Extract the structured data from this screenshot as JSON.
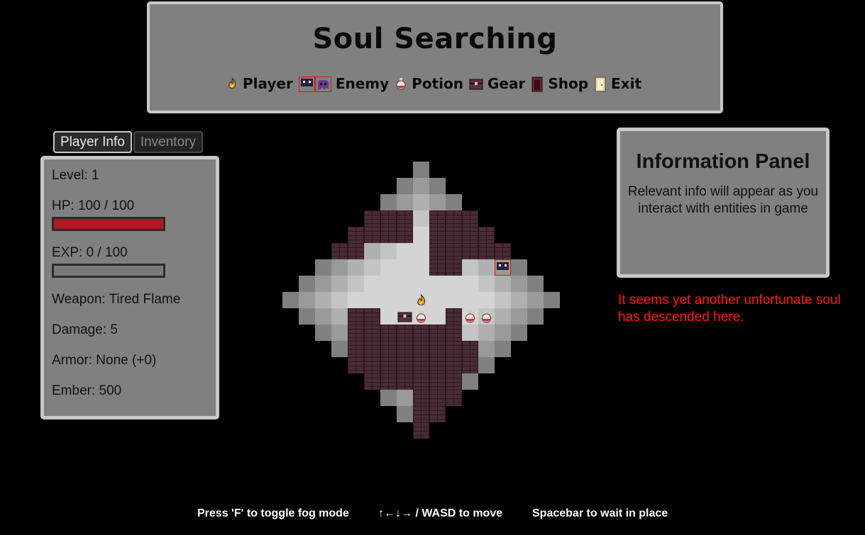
{
  "header": {
    "title": "Soul Searching",
    "legend": {
      "player": "Player",
      "enemy": "Enemy",
      "potion": "Potion",
      "gear": "Gear",
      "shop": "Shop",
      "exit": "Exit"
    }
  },
  "tabs": {
    "player_info": "Player Info",
    "inventory": "Inventory"
  },
  "player": {
    "level": "Level: 1",
    "hp": "HP: 100 / 100",
    "hp_fraction": 1.0,
    "exp": "EXP: 0 / 100",
    "exp_fraction": 0.0,
    "weapon": "Weapon: Tired Flame",
    "damage": "Damage: 5",
    "armor": "Armor: None (+0)",
    "ember": "Ember: 500"
  },
  "info_panel": {
    "title": "Information Panel",
    "text": "Relevant info will appear as you interact with entities in game"
  },
  "message": "It seems yet another unfortunate soul has descended here.",
  "footer": {
    "fog": "Press 'F' to toggle fog mode",
    "move": "↑←↓→ / WASD to move",
    "wait": "Spacebar to wait in place"
  },
  "colors": {
    "accent_red": "#ff1a1a",
    "hp_bar": "#b01822",
    "panel": "#808080",
    "panel_border": "#c8c8c8"
  },
  "icons": {
    "player": "flame-icon",
    "enemy": "ghost-enemy-icon",
    "potion": "potion-flask-icon",
    "gear": "treasure-chest-icon",
    "shop": "shop-door-icon",
    "exit": "exit-door-icon"
  }
}
